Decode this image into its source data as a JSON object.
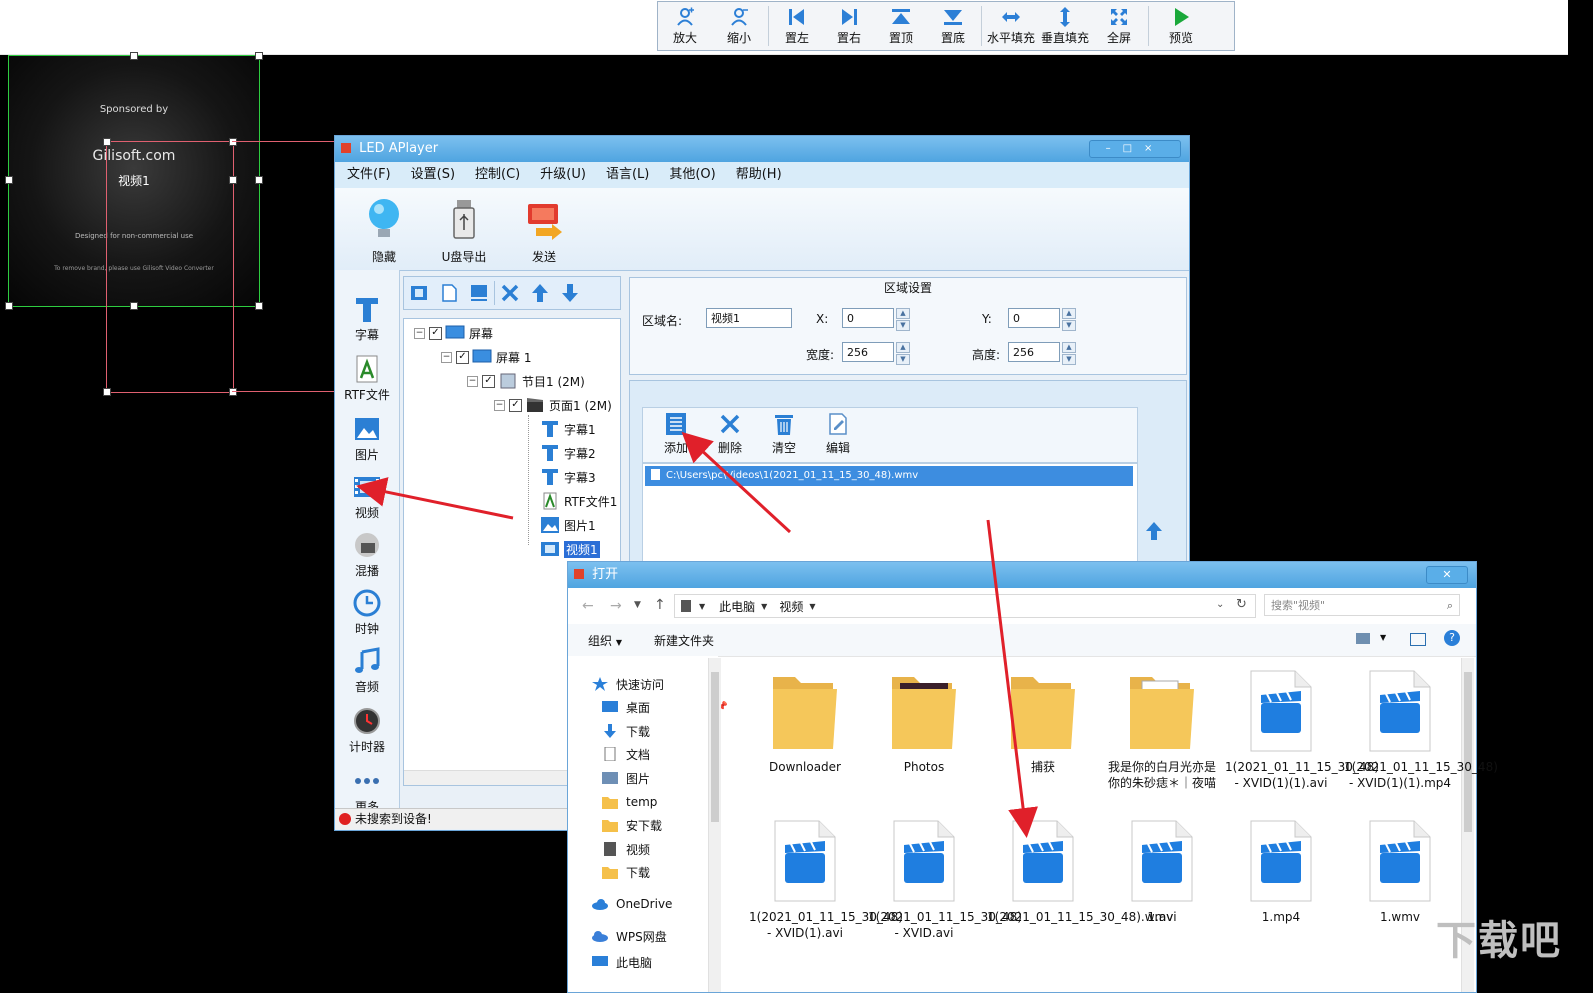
{
  "toolbar": {
    "zoom_in": "放大",
    "zoom_out": "缩小",
    "align_left": "置左",
    "align_right": "置右",
    "align_top": "置顶",
    "align_bottom": "置底",
    "fill_horizontal": "水平填充",
    "fill_vertical": "垂直填充",
    "fullscreen": "全屏",
    "preview": "预览"
  },
  "preview": {
    "line1": "Sponsored by",
    "brand": "Gilisoft.com",
    "region_label": "视频1",
    "line_designed": "Designed for non-commercial use",
    "line_remove": "To remove brand, please use Gilisoft Video Converter"
  },
  "main_window": {
    "title": "LED APlayer",
    "menu": [
      "文件(F)",
      "设置(S)",
      "控制(C)",
      "升级(U)",
      "语言(L)",
      "其他(O)",
      "帮助(H)"
    ],
    "ribbon": {
      "hide": "隐藏",
      "usb_export": "U盘导出",
      "send": "发送"
    },
    "left_tools": [
      "字幕",
      "RTF文件",
      "图片",
      "视频",
      "混播",
      "时钟",
      "音频",
      "计时器",
      "更多"
    ],
    "tree": {
      "screen_root": "屏幕",
      "screen1": "屏幕 1",
      "program1": "节目1 (2M)",
      "page1": "页面1 (2M)",
      "items": [
        "字幕1",
        "字幕2",
        "字幕3",
        "RTF文件1",
        "图片1",
        "视频1"
      ]
    },
    "region": {
      "title": "区域设置",
      "name_label": "区域名:",
      "name_value": "视频1",
      "x_label": "X:",
      "x_value": "0",
      "y_label": "Y:",
      "y_value": "0",
      "width_label": "宽度:",
      "width_value": "256",
      "height_label": "高度:",
      "height_value": "256"
    },
    "media_toolbar": {
      "add": "添加",
      "delete": "删除",
      "clear": "清空",
      "edit": "编辑"
    },
    "media_file": "C:\\Users\\pc\\Videos\\1(2021_01_11_15_30_48).wmv",
    "status": "未搜索到设备!"
  },
  "dialog": {
    "title": "打开",
    "path": [
      "此电脑",
      "视频"
    ],
    "search_placeholder": "搜索\"视频\"",
    "organize": "组织",
    "new_folder": "新建文件夹",
    "nav": [
      "快速访问",
      "桌面",
      "下载",
      "文档",
      "图片",
      "temp",
      "安下载",
      "视频",
      "下载",
      "OneDrive",
      "WPS网盘",
      "此电脑"
    ],
    "files": [
      {
        "name": "Downloader",
        "type": "folder"
      },
      {
        "name": "Photos",
        "type": "folder-photo"
      },
      {
        "name": "捕获",
        "type": "folder"
      },
      {
        "name": "我是你的白月光亦是你的朱砂痣＊｜夜喵",
        "type": "folder-doc"
      },
      {
        "name": "1(2021_01_11_15_30_48) - XVID(1)(1).avi",
        "type": "video"
      },
      {
        "name": "1(2021_01_11_15_30_48) - XVID(1)(1).mp4",
        "type": "video"
      },
      {
        "name": "1(2021_01_11_15_30_48) - XVID(1).avi",
        "type": "video"
      },
      {
        "name": "1(2021_01_11_15_30_48) - XVID.avi",
        "type": "video"
      },
      {
        "name": "1(2021_01_11_15_30_48).wmv",
        "type": "video"
      },
      {
        "name": "1.avi",
        "type": "video"
      },
      {
        "name": "1.mp4",
        "type": "video"
      },
      {
        "name": "1.wmv",
        "type": "video"
      }
    ]
  },
  "watermark": "下载吧",
  "colors": {
    "accent": "#4fa4e0",
    "arrow": "#e0202a",
    "selection": "#3d8de0",
    "folder": "#f5c04a",
    "video": "#1f7ee0"
  }
}
